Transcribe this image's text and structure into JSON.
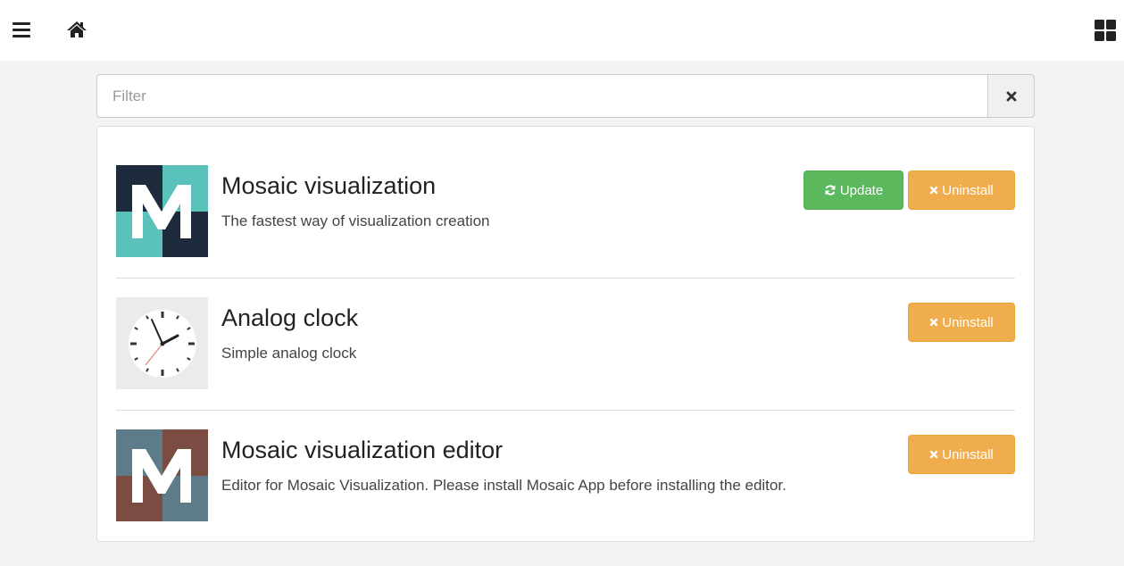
{
  "header": {
    "menu_icon": "menu-icon",
    "home_icon": "home-icon",
    "apps_icon": "apps-grid-icon"
  },
  "filter": {
    "placeholder": "Filter",
    "value": "",
    "clear_icon": "close-icon"
  },
  "apps": [
    {
      "title": "Mosaic visualization",
      "description": "The fastest way of visualization creation",
      "update_label": "Update",
      "uninstall_label": "Uninstall"
    },
    {
      "title": "Analog clock",
      "description": "Simple analog clock",
      "uninstall_label": "Uninstall"
    },
    {
      "title": "Mosaic visualization editor",
      "description": "Editor for Mosaic Visualization. Please install Mosaic App before installing the editor.",
      "uninstall_label": "Uninstall"
    }
  ],
  "colors": {
    "update": "#5cb85c",
    "uninstall": "#f0ad4e",
    "mosaic_dark": "#1d2b3d",
    "mosaic_teal": "#5bc2bb",
    "editor_brown": "#7a4c42",
    "editor_slate": "#5e7b89"
  }
}
